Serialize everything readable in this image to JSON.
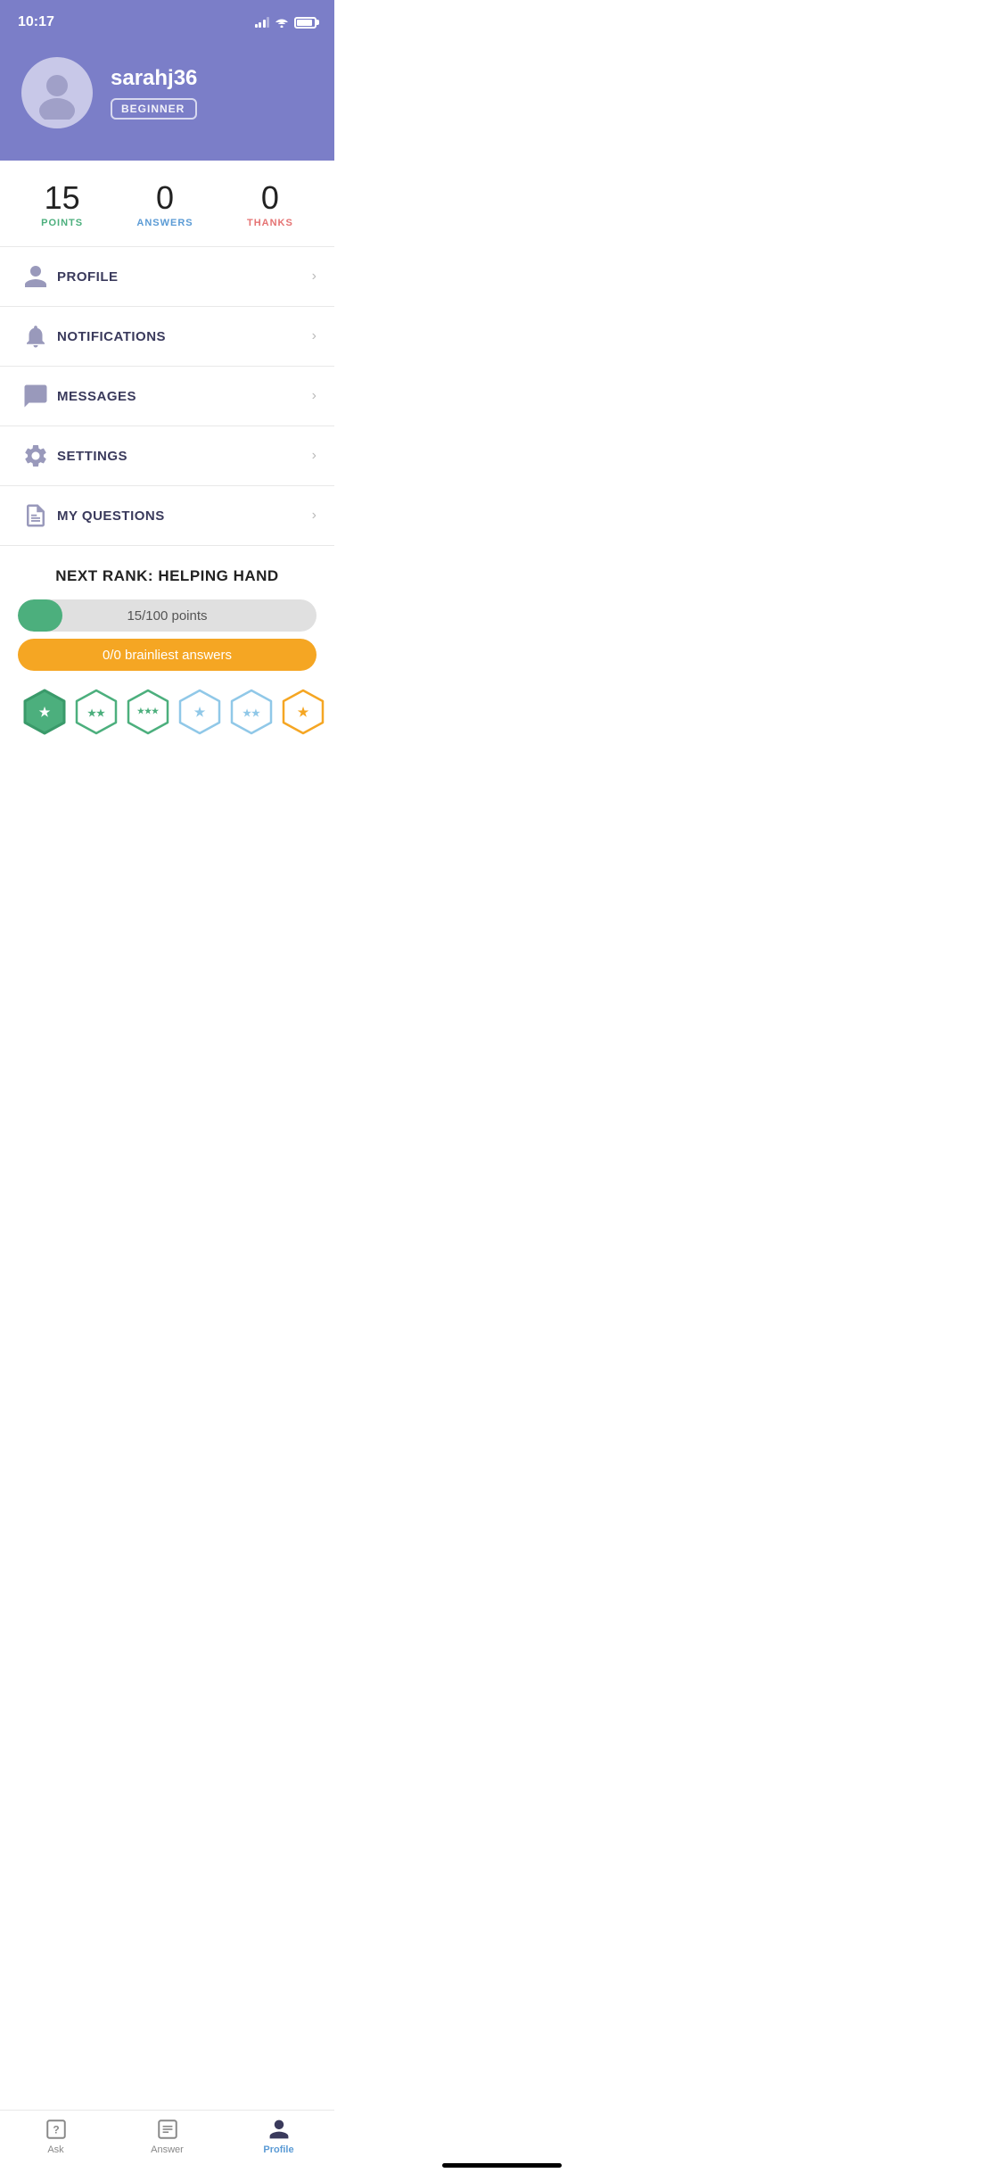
{
  "statusBar": {
    "time": "10:17"
  },
  "profile": {
    "username": "sarahj36",
    "rank": "BEGINNER"
  },
  "stats": {
    "points": {
      "value": "15",
      "label": "POINTS"
    },
    "answers": {
      "value": "0",
      "label": "ANSWERS"
    },
    "thanks": {
      "value": "0",
      "label": "THANKS"
    }
  },
  "menuItems": [
    {
      "id": "profile",
      "label": "PROFILE"
    },
    {
      "id": "notifications",
      "label": "NOTIFICATIONS"
    },
    {
      "id": "messages",
      "label": "MESSAGES"
    },
    {
      "id": "settings",
      "label": "SETTINGS"
    },
    {
      "id": "my-questions",
      "label": "MY QUESTIONS"
    }
  ],
  "rankSection": {
    "title": "NEXT RANK: HELPING HAND",
    "progressText": "15/100 points",
    "progressPercent": 15,
    "brainliestText": "0/0 brainliest answers"
  },
  "bottomNav": {
    "items": [
      {
        "id": "ask",
        "label": "Ask",
        "active": false
      },
      {
        "id": "answer",
        "label": "Answer",
        "active": false
      },
      {
        "id": "profile",
        "label": "Profile",
        "active": true
      }
    ]
  }
}
